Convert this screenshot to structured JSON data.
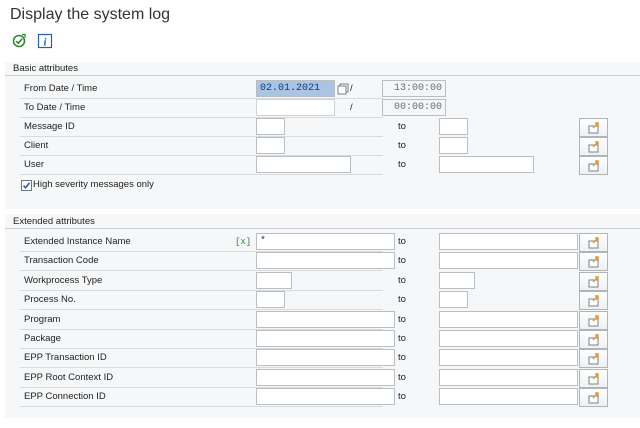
{
  "title": "Display the system log",
  "toolbar": {
    "execute_icon": "execute-icon",
    "info_icon": "info-icon",
    "info_glyph": "i"
  },
  "basic": {
    "title": "Basic attributes",
    "from_label": "From Date / Time",
    "to_label": "To Date / Time",
    "from_date": "02.01.2021",
    "from_time": "13:00:00",
    "to_date": "",
    "to_time": "00:00:00",
    "slash": "/",
    "to_text": "to",
    "rows": [
      {
        "label": "Message ID",
        "from": "",
        "to": ""
      },
      {
        "label": "Client",
        "from": "",
        "to": ""
      },
      {
        "label": "User",
        "from": "",
        "to": ""
      }
    ],
    "checkbox_label": "High severity messages only",
    "checkbox_checked": true
  },
  "extended": {
    "title": "Extended attributes",
    "to_text": "to",
    "hint": "[x]",
    "rows": [
      {
        "label": "Extended Instance Name",
        "from": "*",
        "to": ""
      },
      {
        "label": "Transaction Code",
        "from": "",
        "to": ""
      },
      {
        "label": "Workprocess Type",
        "from": "",
        "to": ""
      },
      {
        "label": "Process No.",
        "from": "",
        "to": ""
      },
      {
        "label": "Program",
        "from": "",
        "to": ""
      },
      {
        "label": "Package",
        "from": "",
        "to": ""
      },
      {
        "label": "EPP Transaction ID",
        "from": "",
        "to": ""
      },
      {
        "label": "EPP Root Context ID",
        "from": "",
        "to": ""
      },
      {
        "label": "EPP Connection ID",
        "from": "",
        "to": ""
      }
    ]
  },
  "colors": {
    "selection": "#a9c4e4",
    "group_bg": "#f6f7f8",
    "execute_green": "#2f8a2f",
    "info_blue": "#1f5fbf",
    "multisel_orange": "#e39a2b"
  }
}
